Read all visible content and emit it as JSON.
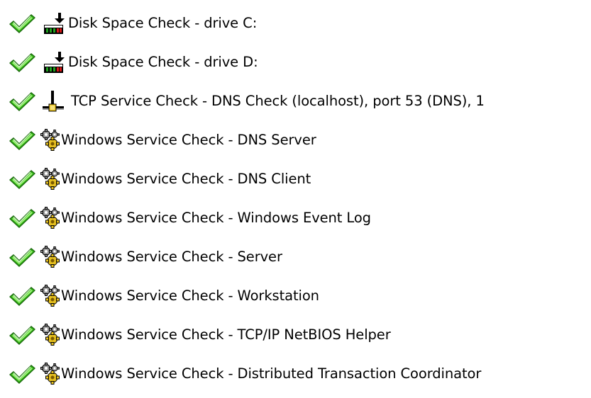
{
  "colors": {
    "ok_green": "#35b816",
    "ok_green_light": "#9df07a",
    "ok_outline": "#1d6b10",
    "gear_gray": "#9a9a9a",
    "gear_gold": "#e6c020",
    "disk_red": "#d41818",
    "disk_green": "#1ea01e",
    "text": "#000000"
  },
  "checks": [
    {
      "status_icon": "green-checkmark-icon",
      "type_icon": "disk-space-icon",
      "label": "Disk Space Check - drive C:"
    },
    {
      "status_icon": "green-checkmark-icon",
      "type_icon": "disk-space-icon",
      "label": "Disk Space Check - drive D:"
    },
    {
      "status_icon": "green-checkmark-icon",
      "type_icon": "network-connection-icon",
      "label": "TCP Service Check - DNS Check (localhost), port 53 (DNS), 1"
    },
    {
      "status_icon": "green-checkmark-icon",
      "type_icon": "windows-service-gears-icon",
      "label": "Windows Service Check - DNS Server"
    },
    {
      "status_icon": "green-checkmark-icon",
      "type_icon": "windows-service-gears-icon",
      "label": "Windows Service Check - DNS Client"
    },
    {
      "status_icon": "green-checkmark-icon",
      "type_icon": "windows-service-gears-icon",
      "label": "Windows Service Check - Windows Event Log"
    },
    {
      "status_icon": "green-checkmark-icon",
      "type_icon": "windows-service-gears-icon",
      "label": "Windows Service Check - Server"
    },
    {
      "status_icon": "green-checkmark-icon",
      "type_icon": "windows-service-gears-icon",
      "label": "Windows Service Check - Workstation"
    },
    {
      "status_icon": "green-checkmark-icon",
      "type_icon": "windows-service-gears-icon",
      "label": "Windows Service Check - TCP/IP NetBIOS Helper"
    },
    {
      "status_icon": "green-checkmark-icon",
      "type_icon": "windows-service-gears-icon",
      "label": "Windows Service Check - Distributed Transaction Coordinator"
    }
  ]
}
